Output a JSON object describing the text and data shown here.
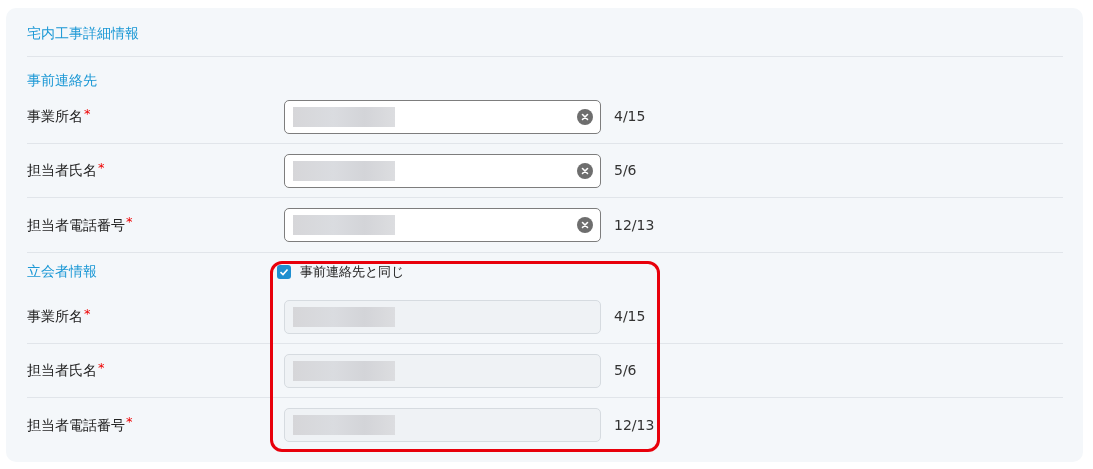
{
  "title": "宅内工事詳細情報",
  "sections": [
    {
      "heading": "事前連絡先",
      "highlighted": false,
      "fields": [
        {
          "label": "事業所名",
          "required_mark": "*",
          "disabled": false,
          "counter": "4/15"
        },
        {
          "label": "担当者氏名",
          "required_mark": "*",
          "disabled": false,
          "counter": "5/6"
        },
        {
          "label": "担当者電話番号",
          "required_mark": "*",
          "disabled": false,
          "counter": "12/13"
        }
      ]
    },
    {
      "heading": "立会者情報",
      "highlighted": true,
      "same_as": {
        "label": "事前連絡先と同じ",
        "checked": true
      },
      "fields": [
        {
          "label": "事業所名",
          "required_mark": "*",
          "disabled": true,
          "counter": "4/15"
        },
        {
          "label": "担当者氏名",
          "required_mark": "*",
          "disabled": true,
          "counter": "5/6"
        },
        {
          "label": "担当者電話番号",
          "required_mark": "*",
          "disabled": true,
          "counter": "12/13"
        }
      ]
    }
  ]
}
